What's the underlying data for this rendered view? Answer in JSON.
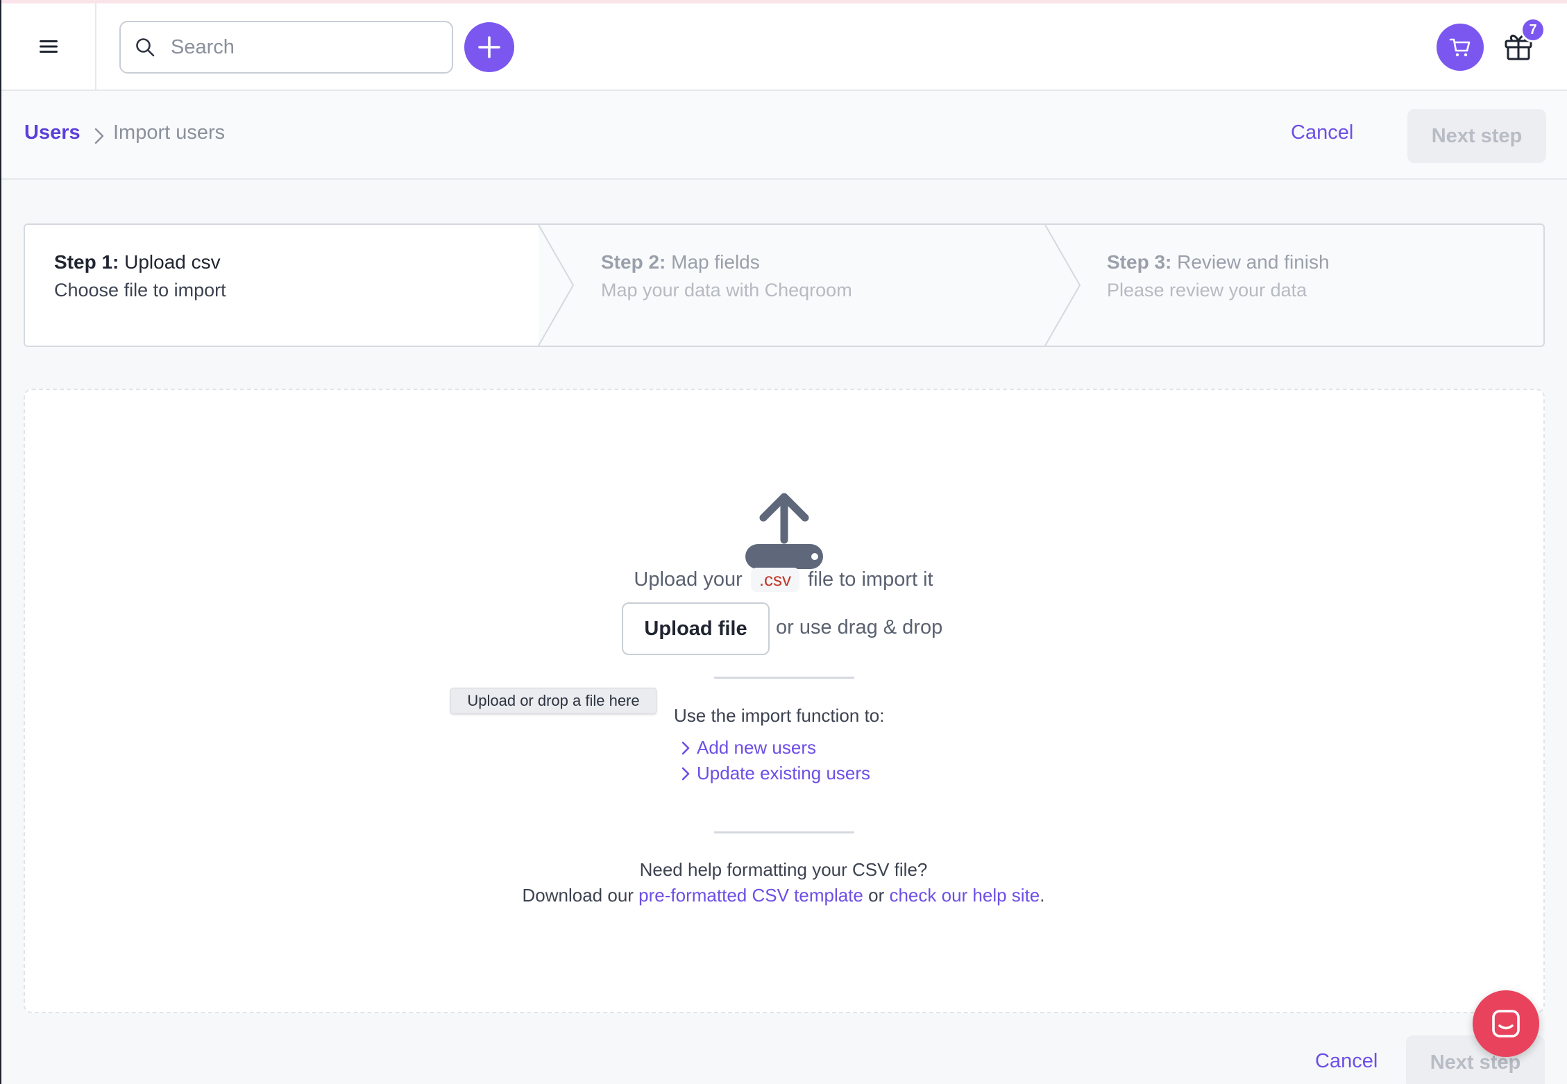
{
  "topbar": {
    "search_placeholder": "Search",
    "gift_badge_count": "7",
    "icons": [
      "menu-icon",
      "search-icon",
      "plus-icon",
      "cart-icon",
      "gift-icon"
    ],
    "accent_color": "#7b57f0"
  },
  "breadcrumb": {
    "root": "Users",
    "current": "Import users"
  },
  "actions": {
    "cancel_label": "Cancel",
    "next_label": "Next step"
  },
  "steps": [
    {
      "prefix": "Step 1:",
      "title": "Upload csv",
      "subtitle": "Choose file to import",
      "active": true
    },
    {
      "prefix": "Step 2:",
      "title": "Map fields",
      "subtitle": "Map your data with Cheqroom",
      "active": false
    },
    {
      "prefix": "Step 3:",
      "title": "Review and finish",
      "subtitle": "Please review your data",
      "active": false
    }
  ],
  "upload": {
    "line_before": "Upload your",
    "file_ext": ".csv",
    "line_after": "file to import it",
    "button_label": "Upload file",
    "drag_text": "or use drag & drop",
    "tooltip": "Upload or drop a file here"
  },
  "import_info": {
    "title": "Use the import function to:",
    "links": [
      "Add new users",
      "Update existing users"
    ]
  },
  "help": {
    "line1": "Need help formatting your CSV file?",
    "line2_before": "Download our",
    "template_link": "pre-formatted CSV template",
    "line2_middle": "or",
    "help_link": "check our help site",
    "line2_after": "."
  },
  "colors": {
    "link": "#6d4fe6",
    "disabled_button_bg": "#eceef1",
    "chat_button": "#e8425c",
    "csv_text": "#c0392b"
  }
}
